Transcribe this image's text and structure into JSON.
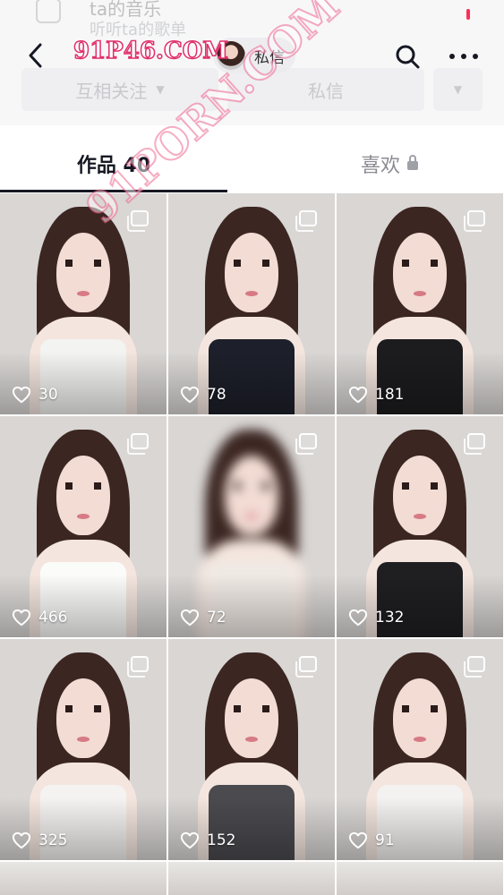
{
  "header": {
    "music_title": "ta的音乐",
    "music_subtitle": "听听ta的歌单",
    "dm_label": "私信",
    "follow_button_label": "互相关注",
    "message_button_label": "私信"
  },
  "watermarks": [
    "91P46.COM",
    "91PORN.COM"
  ],
  "icons": {
    "back": "chevron-left-icon",
    "search": "search-icon",
    "more": "more-dots-icon",
    "like": "heart-icon",
    "multi": "multi-image-icon",
    "lock": "lock-icon"
  },
  "tabs": {
    "works": "作品 40",
    "likes": "喜欢"
  },
  "colors": {
    "accent_red": "#fe2c55",
    "tab_active": "#161823",
    "tab_inactive": "#8a8b91"
  },
  "grid": [
    {
      "likes": "30",
      "outfit": "#f3f3f1"
    },
    {
      "likes": "78",
      "outfit": "#1d1f2a"
    },
    {
      "likes": "181",
      "outfit": "#1c1c1e"
    },
    {
      "likes": "466",
      "outfit": "#fbfbfa"
    },
    {
      "likes": "72",
      "outfit": "#efe9e4"
    },
    {
      "likes": "132",
      "outfit": "#1f1f22"
    },
    {
      "likes": "325",
      "outfit": "#f5f3f1"
    },
    {
      "likes": "152",
      "outfit": "#4a4a4f"
    },
    {
      "likes": "91",
      "outfit": "#f4f2f0"
    }
  ]
}
